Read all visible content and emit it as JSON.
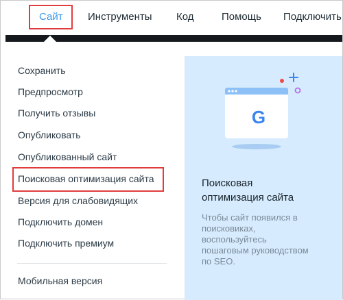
{
  "menu": {
    "items": [
      {
        "label": "Сайт"
      },
      {
        "label": "Инструменты"
      },
      {
        "label": "Код"
      },
      {
        "label": "Помощь"
      },
      {
        "label": "Подключить"
      }
    ],
    "active_index": 0
  },
  "dropdown": {
    "items": [
      {
        "label": "Сохранить"
      },
      {
        "label": "Предпросмотр"
      },
      {
        "label": "Получить отзывы"
      },
      {
        "label": "Опубликовать"
      },
      {
        "label": "Опубликованный сайт"
      },
      {
        "label": "Поисковая оптимизация сайта"
      },
      {
        "label": "Версия для слабовидящих"
      },
      {
        "label": "Подключить домен"
      },
      {
        "label": "Подключить премиум"
      },
      {
        "label": "Мобильная версия"
      }
    ],
    "highlighted_index": 5
  },
  "panel": {
    "title_line1": "Поисковая",
    "title_line2": "оптимизация сайта",
    "desc_line1": "Чтобы сайт появился в",
    "desc_line2": "поисковиках,",
    "desc_line3": "воспользуйтесь",
    "desc_line4": "пошаговым руководством",
    "desc_line5": "по SEO.",
    "illustration_letter": "G"
  },
  "colors": {
    "accent": "#3899ec",
    "highlight_border": "#e03c3c",
    "panel_bg": "#d6ebfd",
    "menubar_underline": "#15181c"
  },
  "icons": {
    "illustration": "browser-window-google-icon",
    "plus": "plus-icon"
  }
}
